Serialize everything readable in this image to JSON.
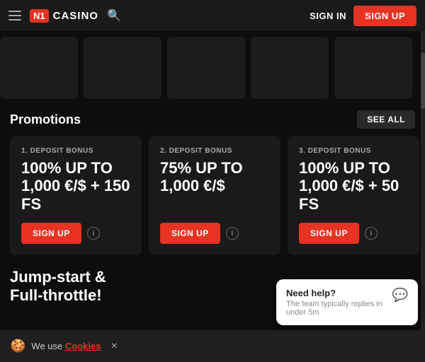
{
  "header": {
    "logo_n1": "N1",
    "logo_casino": "CASINO",
    "signin_label": "SIGN IN",
    "signup_label": "SIGN UP"
  },
  "promotions": {
    "title": "Promotions",
    "see_all_label": "SEE ALL",
    "cards": [
      {
        "deposit_label": "1. DEPOSIT BONUS",
        "amount": "100% UP TO\n1,000 €/$ + 150 FS",
        "signup_label": "SIGN UP"
      },
      {
        "deposit_label": "2. DEPOSIT BONUS",
        "amount": "75% UP TO\n1,000 €/$",
        "signup_label": "SIGN UP"
      },
      {
        "deposit_label": "3. DEPOSIT BONUS",
        "amount": "100% UP TO\n1,000 €/$ + 50 FS",
        "signup_label": "SIGN UP"
      }
    ]
  },
  "jumpstart": {
    "title": "Jump-start &\nFull-throttle!"
  },
  "cookie_bar": {
    "text": "We use ",
    "link": "Cookies"
  },
  "chat_widget": {
    "need_help": "Need help?",
    "subtitle": "The team typically replies in under 5m"
  },
  "icons": {
    "hamburger": "≡",
    "search": "🔍",
    "info": "i",
    "cookie": "🍪",
    "chat": "💬",
    "close": "×"
  }
}
